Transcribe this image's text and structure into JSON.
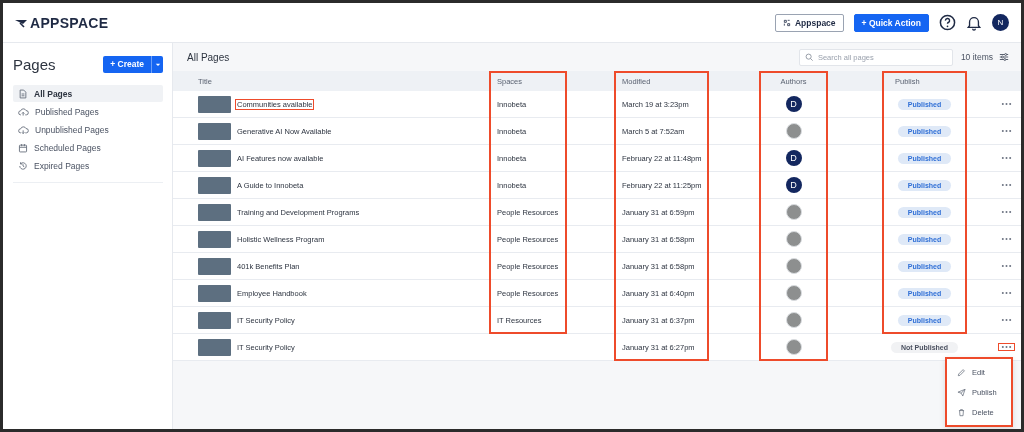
{
  "topbar": {
    "logo": "APPSPACE",
    "buttons": [
      {
        "label": "Appspace",
        "kind": "outline"
      },
      {
        "label": "+ Quick Action",
        "kind": "primary"
      }
    ],
    "avatar": "N"
  },
  "sidebar": {
    "title": "Pages",
    "create_button": "+ Create",
    "items": [
      {
        "label": "All Pages",
        "kind": "document",
        "selected": true
      },
      {
        "label": "Published Pages",
        "kind": "cloud-up",
        "selected": false
      },
      {
        "label": "Unpublished Pages",
        "kind": "cloud-down",
        "selected": false
      },
      {
        "label": "Scheduled Pages",
        "kind": "calendar",
        "selected": false
      },
      {
        "label": "Expired Pages",
        "kind": "history",
        "selected": false
      }
    ]
  },
  "content": {
    "title": "All Pages",
    "search": {
      "placeholder": "Search all pages"
    },
    "count": "10 items",
    "table": {
      "columns": [
        {
          "label": "Title",
          "highlighted": false
        },
        {
          "label": "Spaces",
          "highlighted": true
        },
        {
          "label": "Modified",
          "highlighted": true
        },
        {
          "label": "Authors",
          "highlighted": true
        },
        {
          "label": "Publish",
          "highlighted": true
        }
      ],
      "rows": [
        {
          "title": "Communities available",
          "title_highlighted": true,
          "space": "Innobeta",
          "modified": "March 19 at 3:23pm",
          "author": {
            "kind": "initial",
            "initial": "D"
          },
          "status": {
            "label": "Published",
            "published": true
          },
          "menu_highlighted": false
        },
        {
          "title": "Generative AI Now Available",
          "title_highlighted": false,
          "space": "Innobeta",
          "modified": "March 5 at 7:52am",
          "author": {
            "kind": "photo"
          },
          "status": {
            "label": "Published",
            "published": true
          },
          "menu_highlighted": false
        },
        {
          "title": "AI Features now available",
          "title_highlighted": false,
          "space": "Innobeta",
          "modified": "February 22 at 11:48pm",
          "author": {
            "kind": "initial",
            "initial": "D"
          },
          "status": {
            "label": "Published",
            "published": true
          },
          "menu_highlighted": false
        },
        {
          "title": "A Guide to Innobeta",
          "title_highlighted": false,
          "space": "Innobeta",
          "modified": "February 22 at 11:25pm",
          "author": {
            "kind": "initial",
            "initial": "D"
          },
          "status": {
            "label": "Published",
            "published": true
          },
          "menu_highlighted": false
        },
        {
          "title": "Training and Development Programs",
          "title_highlighted": false,
          "space": "People Resources",
          "modified": "January 31 at 6:59pm",
          "author": {
            "kind": "photo"
          },
          "status": {
            "label": "Published",
            "published": true
          },
          "menu_highlighted": false
        },
        {
          "title": "Holistic Wellness Program",
          "title_highlighted": false,
          "space": "People Resources",
          "modified": "January 31 at 6:58pm",
          "author": {
            "kind": "photo"
          },
          "status": {
            "label": "Published",
            "published": true
          },
          "menu_highlighted": false
        },
        {
          "title": "401k Benefits Plan",
          "title_highlighted": false,
          "space": "People Resources",
          "modified": "January 31 at 6:58pm",
          "author": {
            "kind": "photo"
          },
          "status": {
            "label": "Published",
            "published": true
          },
          "menu_highlighted": false
        },
        {
          "title": "Employee Handbook",
          "title_highlighted": false,
          "space": "People Resources",
          "modified": "January 31 at 6:40pm",
          "author": {
            "kind": "photo"
          },
          "status": {
            "label": "Published",
            "published": true
          },
          "menu_highlighted": false
        },
        {
          "title": "IT Security Policy",
          "title_highlighted": false,
          "space": "IT Resources",
          "modified": "January 31 at 6:37pm",
          "author": {
            "kind": "photo"
          },
          "status": {
            "label": "Published",
            "published": true
          },
          "menu_highlighted": false
        },
        {
          "title": "IT Security Policy",
          "title_highlighted": false,
          "modified": "January 31 at 6:27pm",
          "author": {
            "kind": "photo"
          },
          "status": {
            "label": "Not Published",
            "published": false
          },
          "menu_highlighted": true
        }
      ]
    },
    "row_menu": {
      "highlighted": true,
      "items": [
        {
          "label": "Edit",
          "kind": "edit"
        },
        {
          "label": "Publish",
          "kind": "publish"
        },
        {
          "label": "Delete",
          "kind": "delete"
        }
      ]
    }
  }
}
